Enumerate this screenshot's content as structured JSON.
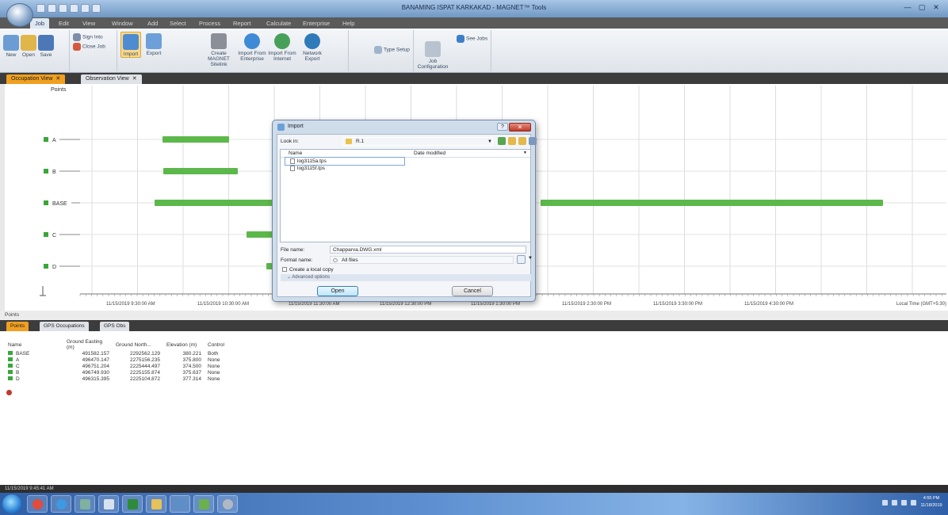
{
  "window": {
    "title": "BANAMING ISPAT KARKAKAD - MAGNET™ Tools",
    "minimize": "—",
    "maximize": "▢",
    "close": "✕"
  },
  "ribbon": {
    "tabs": [
      "Job",
      "Edit",
      "View",
      "Window",
      "Add",
      "Select",
      "Process",
      "Report",
      "Calculate",
      "Enterprise",
      "Help"
    ],
    "buttons": {
      "save": "Save",
      "open": "Open",
      "new": "New",
      "sign_in": "Sign Into",
      "close_job": "Close Job",
      "import": "Import",
      "export": "Export",
      "create_magnet_sitelink": "Create MAGNET Sitelink",
      "import_from_enterprise": "Import From Enterprise",
      "import_from_internet": "Import From Internet",
      "network_export": "Network Export",
      "type_setup": "Type Setup",
      "job_configuration": "Job Configuration",
      "job_setup": "See Jobs"
    }
  },
  "doc_tabs": [
    {
      "label": "Occupation View",
      "close": "✕"
    },
    {
      "label": "Observation View",
      "close": "✕"
    }
  ],
  "chart": {
    "points_header": "Points",
    "rows": [
      {
        "label": "A"
      },
      {
        "label": "B"
      },
      {
        "label": "BASE"
      },
      {
        "label": "C"
      },
      {
        "label": "D"
      }
    ],
    "time_labels": [
      "11/15/2019 9:30:00 AM",
      "11/15/2019 10:30:00 AM",
      "11/15/2019 11:30:00 AM",
      "11/15/2019 12:30:00 PM",
      "11/15/2019 1:30:00 PM",
      "11/15/2019 2:30:00 PM",
      "11/15/2019 3:30:00 PM",
      "11/15/2019 4:30:00 PM"
    ],
    "local_time_label": "Local Time (GMT+5:30)",
    "bar_color": "#5cb84a"
  },
  "bottom": {
    "panel_title": "Points",
    "tabs": [
      "Points",
      "GPS Occupations",
      "GPS Obs"
    ],
    "columns": [
      "Name",
      "Ground Easting (m)",
      "Ground North...",
      "Elevation (m)",
      "Control"
    ],
    "rows": [
      [
        "BASE",
        "491582.157",
        "2292562.129",
        "380.221",
        "Both"
      ],
      [
        "A",
        "496470.147",
        "2275156.235",
        "375.800",
        "None"
      ],
      [
        "C",
        "496751.204",
        "2225444.497",
        "374.500",
        "None"
      ],
      [
        "B",
        "496749.930",
        "2225155.874",
        "375.637",
        "None"
      ],
      [
        "D",
        "496315.395",
        "2225104.872",
        "377.314",
        "None"
      ]
    ]
  },
  "status": {
    "text": "11/15/2019 9:45:41 AM"
  },
  "taskbar": {
    "clock_time": "4:55 PM",
    "clock_date": "11/18/2019"
  },
  "dialog": {
    "title": "Import",
    "help": "?",
    "close": "✕",
    "look_in_label": "Look in:",
    "look_in_value": "R.1",
    "col_name": "Name",
    "col_date": "Date modified",
    "files": [
      "log3115a.tps",
      "log3115f.tps"
    ],
    "file_name_label": "File name:",
    "file_name_value": "Chapparva.DWG.xml",
    "format_label": "Format name:",
    "format_value": "All files",
    "local_copy_label": "Create a local copy",
    "advanced_label": "Advanced options",
    "open_label": "Open",
    "cancel_label": "Cancel"
  }
}
